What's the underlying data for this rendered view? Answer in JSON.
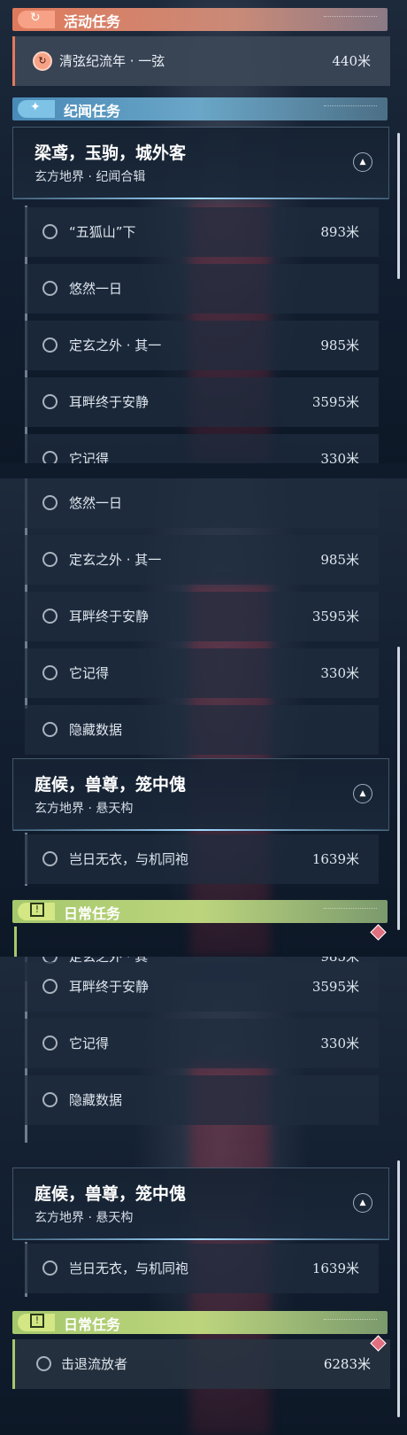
{
  "categories": {
    "active": "活动任务",
    "story": "纪闻任务",
    "daily": "日常任务"
  },
  "active_quest": {
    "name": "清弦纪流年 · 一弦",
    "dist": "440米"
  },
  "story_groups": [
    {
      "title": "梁鸢，玉驹，城外客",
      "sub": "玄方地界 · 纪闻合辑"
    },
    {
      "title": "庭候，兽尊，笼中傀",
      "sub": "玄方地界 · 悬天构"
    }
  ],
  "quests": [
    {
      "name": "“五狐山”下",
      "dist": "893米"
    },
    {
      "name": "悠然一日",
      "dist": ""
    },
    {
      "name": "定玄之外 · 其一",
      "dist": "985米"
    },
    {
      "name": "耳畔终于安静",
      "dist": "3595米"
    },
    {
      "name": "它记得",
      "dist": "330米"
    },
    {
      "name": "隐藏数据",
      "dist": ""
    },
    {
      "name": "岂日无衣，与机同袍",
      "dist": "1639米"
    }
  ],
  "daily_quest": {
    "name": "击退流放者",
    "dist": "6283米"
  },
  "icons": {
    "active": "refresh-arrow-icon",
    "story": "sparkle-icon",
    "daily": "exclamation-box-icon",
    "collapse": "chevron-up-icon",
    "tracked": "red-diamond-icon"
  },
  "colors": {
    "active_accent": "#e07a5c",
    "story_accent": "#6aa6c7",
    "daily_accent": "#a6c86c"
  }
}
